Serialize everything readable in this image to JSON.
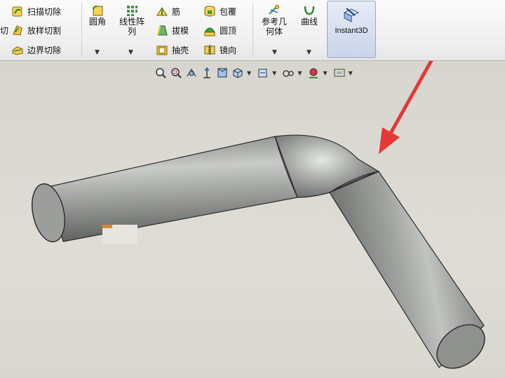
{
  "ribbon": {
    "partial_left_label": "切",
    "cut_group": [
      {
        "label": "扫描切除",
        "icon": "swept-cut-icon"
      },
      {
        "label": "放样切割",
        "icon": "lofted-cut-icon"
      },
      {
        "label": "边界切除",
        "icon": "boundary-cut-icon"
      }
    ],
    "fillet_label": "圆角",
    "linear_pattern_label_line1": "线性阵",
    "linear_pattern_label_line2": "列",
    "features_col1": [
      {
        "label": "筋",
        "icon": "rib-icon"
      },
      {
        "label": "拔模",
        "icon": "draft-icon"
      },
      {
        "label": "抽壳",
        "icon": "shell-icon"
      }
    ],
    "features_col2": [
      {
        "label": "包覆",
        "icon": "wrap-icon"
      },
      {
        "label": "圆顶",
        "icon": "dome-icon"
      },
      {
        "label": "镜向",
        "icon": "mirror-icon"
      }
    ],
    "ref_geometry_line1": "参考几",
    "ref_geometry_line2": "何体",
    "curves_label": "曲线",
    "instant3d_label": "Instant3D"
  },
  "heads_up_toolbar": [
    "zoom-to-fit-icon",
    "zoom-to-area-icon",
    "previous-view-icon",
    "section-view-icon",
    "view-orientation-icon",
    "display-style-icon",
    "hide-show-items-icon",
    "edit-appearance-icon",
    "apply-scene-icon",
    "view-settings-icon"
  ],
  "colors": {
    "annotation_arrow": "#e53935",
    "model_body": "#9ea09d",
    "viewport_bg": "#d9d8d0"
  }
}
